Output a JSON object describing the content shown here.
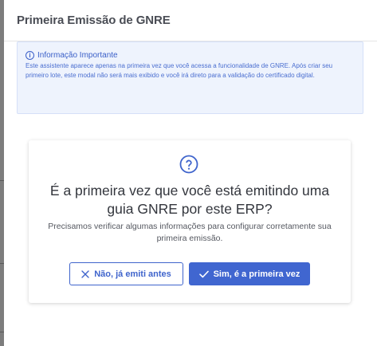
{
  "modal": {
    "title": "Primeira Emissão de GNRE"
  },
  "info": {
    "icon": "info-icon",
    "title": "Informação Importante",
    "text": "Este assistente aparece apenas na primeira vez que você acessa a funcionalidade de GNRE. Após criar seu primeiro lote, este modal não será mais exibido e você irá direto para a validação do certificado digital.",
    "color": "#3a5fc8"
  },
  "card": {
    "icon": "question-circle-icon",
    "question": "É a primeira vez que você está emitindo uma guia GNRE por este ERP?",
    "subtitle": "Precisamos verificar algumas informações para configurar corretamente sua primeira emissão."
  },
  "buttons": {
    "no_label": "Não, já emiti antes",
    "no_icon": "close-icon",
    "yes_label": "Sim, é a primeira vez",
    "yes_icon": "check-icon",
    "accent": "#4066d0"
  }
}
